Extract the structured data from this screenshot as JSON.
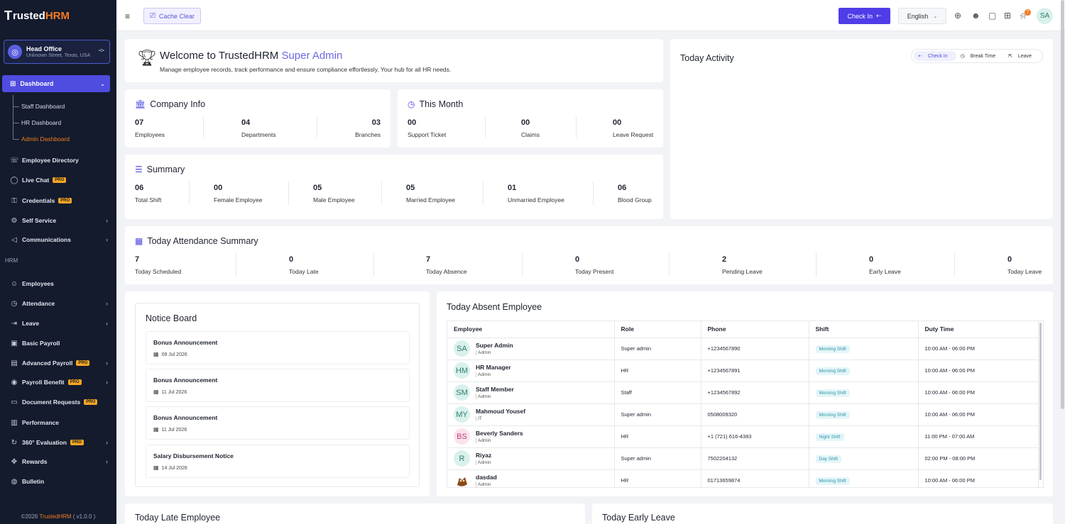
{
  "brand": {
    "name_prefix": "rusted",
    "name_suffix": "HRM",
    "logo_mark": "T"
  },
  "office": {
    "name": "Head Office",
    "address": "Unknown Street, Texas, USA"
  },
  "sidebar": {
    "dashboard": "Dashboard",
    "sub_items": [
      "Staff Dashboard",
      "HR Dashboard",
      "Admin Dashboard"
    ],
    "items": [
      {
        "label": "Employee Directory",
        "icon": "contact-book-icon"
      },
      {
        "label": "Live Chat",
        "icon": "chat-icon",
        "pro": "PRO"
      },
      {
        "label": "Credentials",
        "icon": "key-icon",
        "pro": "PRO"
      },
      {
        "label": "Self Service",
        "icon": "settings-icon"
      },
      {
        "label": "Communications",
        "icon": "megaphone-icon"
      }
    ],
    "section_hrm": "HRM",
    "hrm_items": [
      {
        "label": "Employees",
        "icon": "users-icon"
      },
      {
        "label": "Attendance",
        "icon": "clock-icon"
      },
      {
        "label": "Leave",
        "icon": "exit-icon"
      },
      {
        "label": "Basic Payroll",
        "icon": "money-icon"
      },
      {
        "label": "Advanced Payroll",
        "icon": "wallet-icon",
        "pro": "PRO"
      },
      {
        "label": "Payroll Benefit",
        "icon": "coin-icon",
        "pro": "PRO"
      },
      {
        "label": "Document Requests",
        "icon": "document-icon",
        "pro": "PRO"
      },
      {
        "label": "Performance",
        "icon": "chart-icon"
      },
      {
        "label": "360° Evaluation",
        "icon": "refresh-icon",
        "pro": "PRO"
      },
      {
        "label": "Rewards",
        "icon": "gift-icon"
      },
      {
        "label": "Bulletin",
        "icon": "bulletin-icon"
      }
    ],
    "footer_prefix": "©2026 ",
    "footer_brand": "TrustedHRM",
    "footer_version": " ( v1.0.0 )"
  },
  "topbar": {
    "cache_clear": "Cache Clear",
    "check_in": "Check In",
    "language": "English",
    "notif_count": "7",
    "avatar": "SA"
  },
  "welcome": {
    "title": "Welcome to TrustedHRM",
    "role": "Super Admin",
    "subtitle": "Manage employee records, track performance and ensure compliance effortlessly. Your hub for all HR needs."
  },
  "company_info": {
    "title": "Company Info",
    "stats": [
      {
        "n": "07",
        "l": "Employees"
      },
      {
        "n": "04",
        "l": "Departments"
      },
      {
        "n": "03",
        "l": "Branches"
      }
    ]
  },
  "this_month": {
    "title": "This Month",
    "stats": [
      {
        "n": "00",
        "l": "Support Ticket"
      },
      {
        "n": "00",
        "l": "Claims"
      },
      {
        "n": "00",
        "l": "Leave Request"
      }
    ]
  },
  "summary": {
    "title": "Summary",
    "stats": [
      {
        "n": "06",
        "l": "Total Shift"
      },
      {
        "n": "00",
        "l": "Female Employee"
      },
      {
        "n": "05",
        "l": "Male Employee"
      },
      {
        "n": "05",
        "l": "Married Employee"
      },
      {
        "n": "01",
        "l": "Unmarried Employee"
      },
      {
        "n": "06",
        "l": "Blood Group"
      }
    ]
  },
  "today_activity": {
    "title": "Today Activity",
    "tabs": [
      "Check In",
      "Break Time",
      "Leave"
    ]
  },
  "attendance": {
    "title": "Today Attendance Summary",
    "stats": [
      {
        "n": "7",
        "l": "Today Scheduled"
      },
      {
        "n": "0",
        "l": "Today Late"
      },
      {
        "n": "7",
        "l": "Today Absence"
      },
      {
        "n": "0",
        "l": "Today Present"
      },
      {
        "n": "2",
        "l": "Pending Leave"
      },
      {
        "n": "0",
        "l": "Early Leave"
      },
      {
        "n": "0",
        "l": "Today Leave"
      }
    ]
  },
  "notice_board": {
    "title": "Notice Board",
    "items": [
      {
        "title": "Bonus Announcement",
        "date": "09 Jul 2026"
      },
      {
        "title": "Bonus Announcement",
        "date": "11 Jul 2026"
      },
      {
        "title": "Bonus Announcement",
        "date": "11 Jul 2026"
      },
      {
        "title": "Salary Disbursement Notice",
        "date": "14 Jul 2026"
      }
    ]
  },
  "absent": {
    "title": "Today Absent Employee",
    "columns": [
      "Employee",
      "Role",
      "Phone",
      "Shift",
      "Duty Time"
    ],
    "rows": [
      {
        "initials": "SA",
        "name": "Super Admin",
        "sub": "Admin",
        "role": "Super admin",
        "phone": "+1234567890",
        "shift": "Morning Shift",
        "duty": "10:00 AM - 06:00 PM",
        "bg": "#d9f1ec",
        "fg": "#2c7d6d"
      },
      {
        "initials": "HM",
        "name": "HR Manager",
        "sub": "Admin",
        "role": "HR",
        "phone": "+1234567891",
        "shift": "Morning Shift",
        "duty": "10:00 AM - 06:00 PM",
        "bg": "#d9f1ec",
        "fg": "#2c7d6d"
      },
      {
        "initials": "SM",
        "name": "Staff Member",
        "sub": "Admin",
        "role": "Staff",
        "phone": "+1234567892",
        "shift": "Morning Shift",
        "duty": "10:00 AM - 06:00 PM",
        "bg": "#d9f1ec",
        "fg": "#2c7d6d"
      },
      {
        "initials": "MY",
        "name": "Mahmoud Yousef",
        "sub": "IT",
        "role": "Super admin",
        "phone": "0508009320",
        "shift": "Morning Shift",
        "duty": "10:00 AM - 06:00 PM",
        "bg": "#d9f1ec",
        "fg": "#2c7d6d"
      },
      {
        "initials": "BS",
        "name": "Beverly Sanders",
        "sub": "Admin",
        "role": "HR",
        "phone": "+1 (721) 616-4383",
        "shift": "Night Shift",
        "duty": "11:00 PM - 07:00 AM",
        "bg": "#fbe3ee",
        "fg": "#b8487a"
      },
      {
        "initials": "R",
        "name": "Riyaz",
        "sub": "Admin",
        "role": "Super admin",
        "phone": "7502204132",
        "shift": "Day Shift",
        "duty": "02:00 PM - 08:00 PM",
        "bg": "#d9f1ec",
        "fg": "#2c7d6d"
      },
      {
        "initials": "",
        "name": "dasdad",
        "sub": "Admin",
        "role": "HR",
        "phone": "01713659874",
        "shift": "Morning Shift",
        "duty": "10:00 AM - 06:00 PM",
        "bg": "#ffffff",
        "fg": "#8a4a1c"
      }
    ]
  },
  "late": {
    "title": "Today Late Employee"
  },
  "early": {
    "title": "Today Early Leave"
  }
}
